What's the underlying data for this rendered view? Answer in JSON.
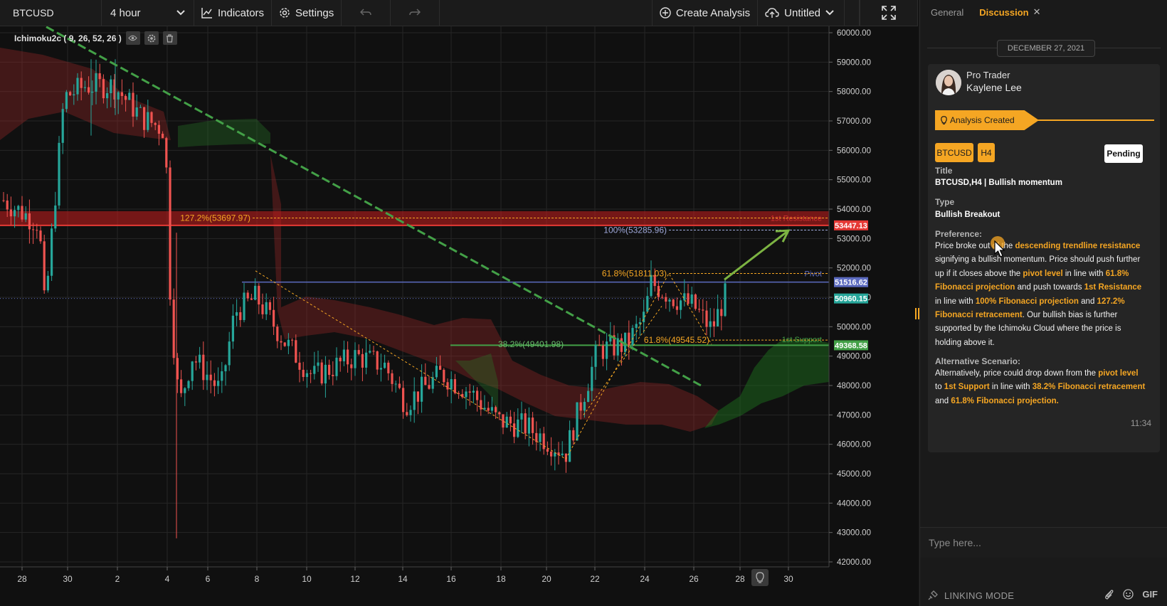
{
  "toolbar": {
    "symbol": "BTCUSD",
    "interval": "4 hour",
    "indicators_label": "Indicators",
    "settings_label": "Settings",
    "create_analysis_label": "Create Analysis",
    "layout_name": "Untitled"
  },
  "indicator_legend": "Ichimoku2c ( 9, 26, 52, 26 )",
  "chart_data": {
    "type": "candlestick",
    "symbol": "BTCUSD",
    "timeframe": "4 hour",
    "y_axis": {
      "min": 42000,
      "max": 60000,
      "ticks": [
        "60000.00",
        "59000.00",
        "58000.00",
        "57000.00",
        "56000.00",
        "55000.00",
        "54000.00",
        "53000.00",
        "52000.00",
        "51000.00",
        "50000.00",
        "49000.00",
        "48000.00",
        "47000.00",
        "46000.00",
        "45000.00",
        "44000.00",
        "43000.00",
        "42000.00"
      ]
    },
    "x_axis": {
      "ticks": [
        "28",
        "30",
        "2",
        "4",
        "6",
        "8",
        "10",
        "12",
        "14",
        "16",
        "18",
        "20",
        "22",
        "24",
        "26",
        "28",
        "30"
      ]
    },
    "price_tags": [
      {
        "price": 53447.13,
        "text": "53447.13",
        "color": "#e53935"
      },
      {
        "price": 51516.62,
        "text": "51516.62",
        "color": "#5c6bc0"
      },
      {
        "price": 50960.15,
        "text": "50960.15",
        "color": "#26a69a"
      },
      {
        "price": 49368.58,
        "text": "49368.58",
        "color": "#43a047"
      }
    ],
    "levels": [
      {
        "price": 53697.97,
        "text": "127.2%(53697.97)",
        "color": "#f5a623"
      },
      {
        "price": 53285.96,
        "text": "100%(53285.96)",
        "color": "#9fa8da"
      },
      {
        "price": 51811.03,
        "text": "61.8%(51811.03)",
        "color": "#f5a623"
      },
      {
        "price": 49545.52,
        "text": "61.8%(49545.52)",
        "color": "#f5a623"
      },
      {
        "price": 49401.98,
        "text": "38.2%(49401.98)",
        "color": "#66bb6a"
      }
    ],
    "zone_labels": {
      "resistance": "1st Resistance",
      "pivot": "Pivot",
      "support": "1st Support"
    },
    "colors": {
      "bull": "#26a69a",
      "bear": "#ef5350",
      "trendline": "#43a047",
      "fib": "#f5a623",
      "pivot": "#5c6bc0"
    }
  },
  "panel": {
    "tabs": {
      "general": "General",
      "discussion": "Discussion"
    },
    "date": "DECEMBER 27, 2021",
    "author_role": "Pro Trader",
    "author_name": "Kaylene Lee",
    "event": "Analysis Created",
    "symbol_badge": "BTCUSD",
    "timeframe_badge": "H4",
    "status": "Pending",
    "title_label": "Title",
    "title_value": "BTCUSD,H4 | Bullish momentum",
    "type_label": "Type",
    "type_value": "Bullish Breakout",
    "preference_label": "Preference:",
    "preference": {
      "t1": "Price broke out of the ",
      "h1": "descending trendline resistance",
      "t2": " signifying a bullish momentum. Price should push further up if it closes above the ",
      "h2": "pivot level",
      "t3": " in line with ",
      "h3": "61.8% Fibonacci projection",
      "t4": " and push towards ",
      "h4": "1st Resistance",
      "t5": " in line with ",
      "h5": "100% Fibonacci projection",
      "t6": " and ",
      "h6": "127.2% Fibonacci retracement",
      "t7": ". Our bullish bias is further supported by the Ichimoku Cloud where the price is holding above it."
    },
    "alternative_label": "Alternative Scenario:",
    "alternative": {
      "t1": "Alternatively, price could drop down from the ",
      "h1": "pivot level",
      "t2": " to ",
      "h2": "1st Support",
      "t3": " in line with ",
      "h3": "38.2% Fibonacci retracement",
      "t4": " and ",
      "h4": "61.8% Fibonacci projection."
    },
    "time": "11:34",
    "input_placeholder": "Type here...",
    "linking_mode": "LINKING MODE",
    "gif_label": "GIF"
  }
}
